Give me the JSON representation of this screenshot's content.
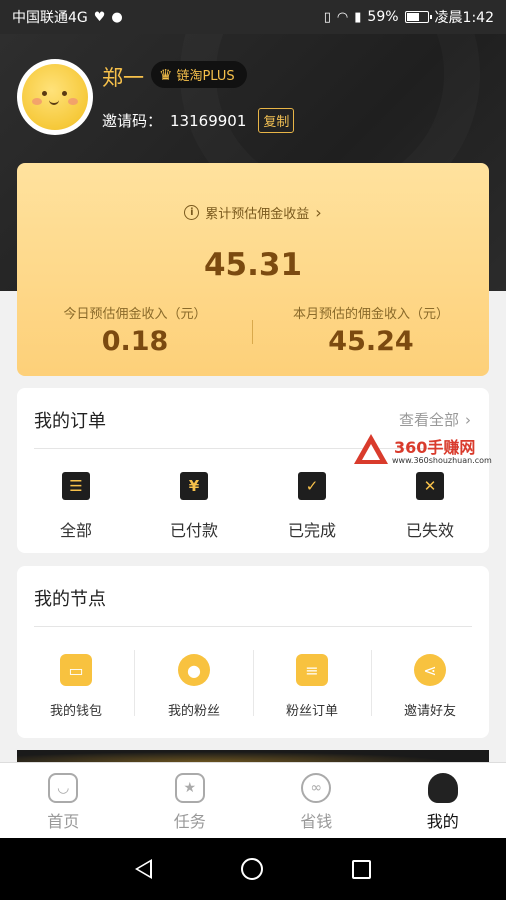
{
  "status_bar": {
    "carrier": "中国联通4G",
    "battery": "59%",
    "time": "凌晨1:42",
    "icons": [
      "heart-monitor-icon",
      "qq-icon",
      "vibrate-icon",
      "wifi-icon",
      "signal-icon",
      "battery-icon"
    ]
  },
  "profile": {
    "name": "郑一",
    "badge": "链淘PLUS",
    "invite_label": "邀请码：",
    "invite_code": "13169901",
    "copy_label": "复制"
  },
  "earnings": {
    "title": "累计预估佣金收益",
    "total": "45.31",
    "today_label": "今日预估佣金收入（元）",
    "today_value": "0.18",
    "month_label": "本月预估的佣金收入（元）",
    "month_value": "45.24"
  },
  "orders": {
    "title": "我的订单",
    "see_all": "查看全部",
    "items": [
      {
        "label": "全部",
        "icon": "clipboard-list-icon"
      },
      {
        "label": "已付款",
        "icon": "yen-paid-icon"
      },
      {
        "label": "已完成",
        "icon": "check-box-icon"
      },
      {
        "label": "已失效",
        "icon": "cross-box-icon"
      }
    ]
  },
  "nodes": {
    "title": "我的节点",
    "items": [
      {
        "label": "我的钱包",
        "icon": "wallet-icon"
      },
      {
        "label": "我的粉丝",
        "icon": "user-icon"
      },
      {
        "label": "粉丝订单",
        "icon": "clipboard-icon"
      },
      {
        "label": "邀请好友",
        "icon": "share-icon"
      }
    ]
  },
  "watermark": {
    "text": "360手赚网",
    "url": "www.360shouzhuan.com"
  },
  "tabs": [
    {
      "label": "首页",
      "icon": "home-bag-icon"
    },
    {
      "label": "任务",
      "icon": "star-bookmark-icon"
    },
    {
      "label": "省钱",
      "icon": "link-icon"
    },
    {
      "label": "我的",
      "icon": "profile-icon",
      "active": true
    }
  ],
  "colors": {
    "accent": "#f7c14b",
    "card_gold": "#fdd079",
    "dark": "#1f1f1f"
  }
}
